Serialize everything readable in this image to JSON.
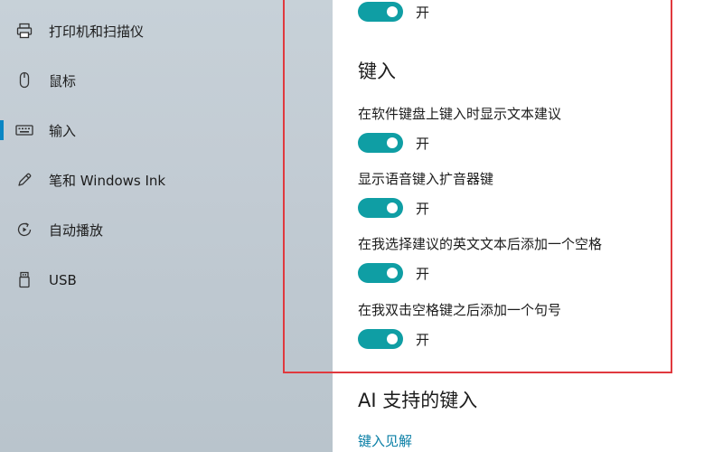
{
  "sidebar": {
    "items": [
      {
        "label": "打印机和扫描仪",
        "icon": "printer-icon",
        "selected": false
      },
      {
        "label": "鼠标",
        "icon": "mouse-icon",
        "selected": false
      },
      {
        "label": "输入",
        "icon": "keyboard-icon",
        "selected": true
      },
      {
        "label": "笔和 Windows Ink",
        "icon": "pen-icon",
        "selected": false
      },
      {
        "label": "自动播放",
        "icon": "autoplay-icon",
        "selected": false
      },
      {
        "label": "USB",
        "icon": "usb-icon",
        "selected": false
      }
    ]
  },
  "main": {
    "top_toggle": {
      "state": "开",
      "on": true
    },
    "typing_section": {
      "heading": "键入",
      "settings": [
        {
          "label": "在软件键盘上键入时显示文本建议",
          "state": "开",
          "on": true
        },
        {
          "label": "显示语音键入扩音器键",
          "state": "开",
          "on": true
        },
        {
          "label": "在我选择建议的英文文本后添加一个空格",
          "state": "开",
          "on": true
        },
        {
          "label": "在我双击空格键之后添加一个句号",
          "state": "开",
          "on": true
        }
      ]
    },
    "ai_section": {
      "heading": "AI 支持的键入",
      "link": "键入见解"
    }
  },
  "colors": {
    "accent": "#0a86c4",
    "toggle_on": "#0f9ea4",
    "highlight_border": "#e0393e",
    "link": "#0a7fa6"
  }
}
